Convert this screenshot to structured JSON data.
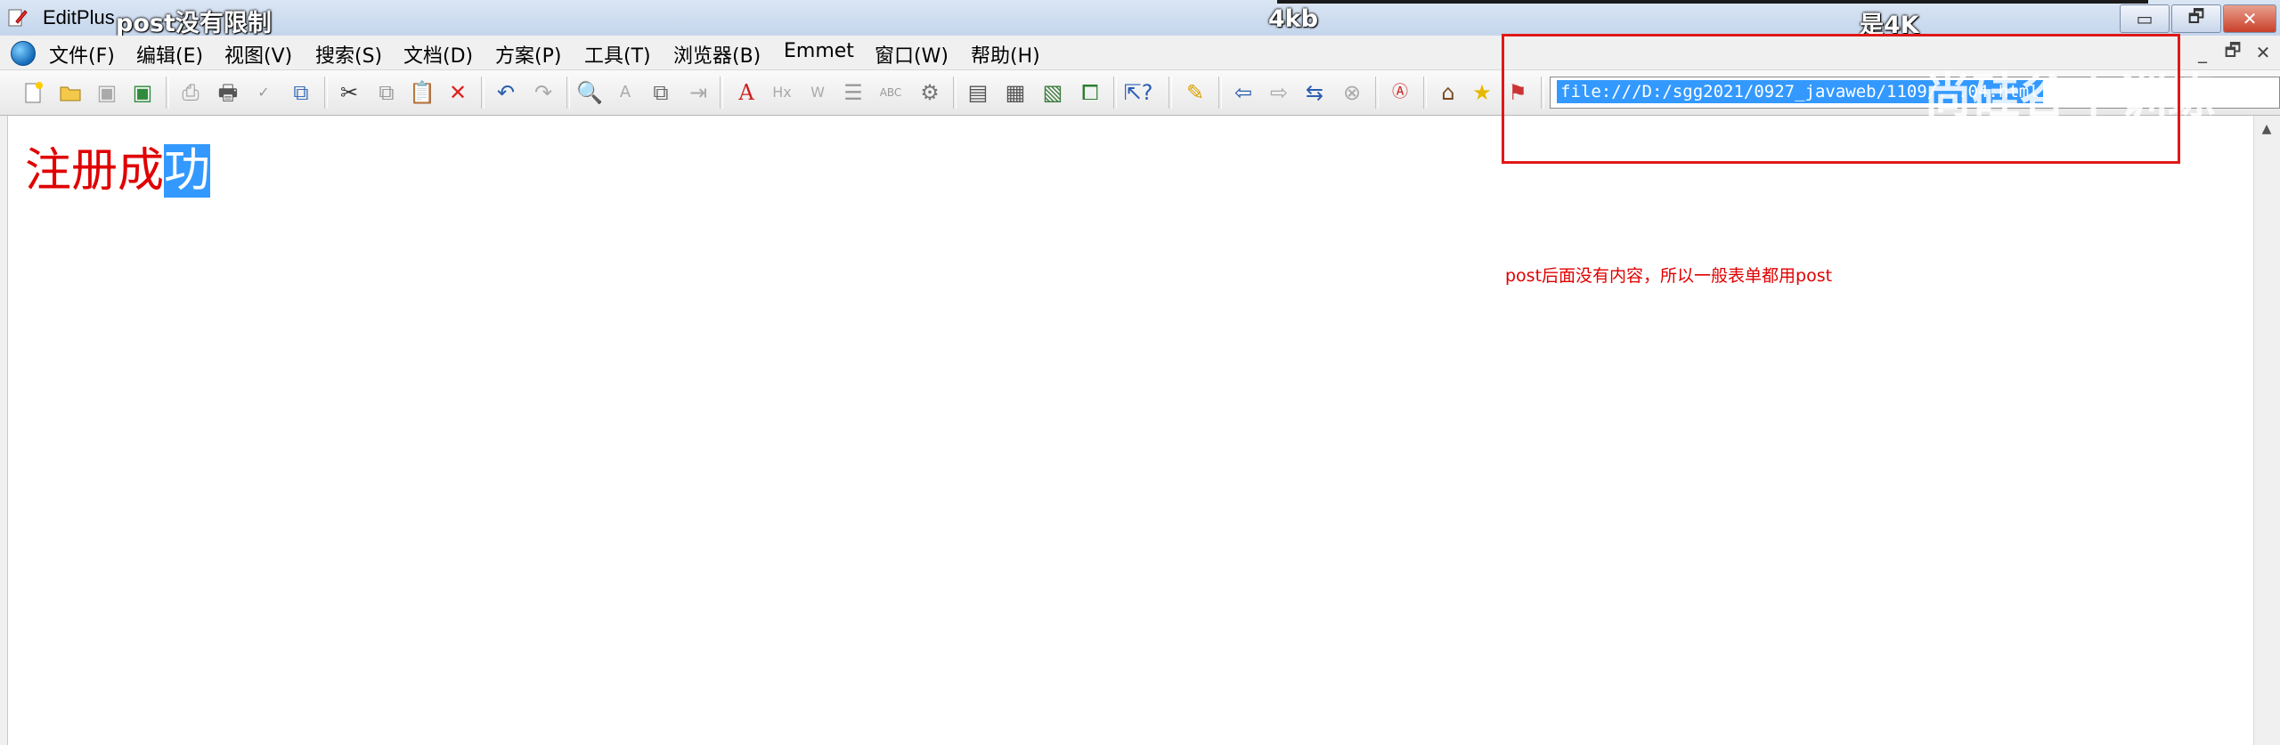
{
  "window": {
    "title": "EditPlus",
    "title_suffix": "- [",
    "buttons": {
      "minimize": "▭",
      "restore": "🗗",
      "close": "✕"
    }
  },
  "captions": {
    "left": "post没有限制",
    "center": "4kb",
    "right": "是4K"
  },
  "menu": {
    "items": [
      "文件(F)",
      "编辑(E)",
      "视图(V)",
      "搜索(S)",
      "文档(D)",
      "方案(P)",
      "工具(T)",
      "浏览器(B)",
      "Emmet",
      "窗口(W)",
      "帮助(H)"
    ],
    "mdi_buttons": [
      "_",
      "🗗",
      "✕"
    ]
  },
  "toolbar": {
    "url": "file:///D:/sgg2021/0927_javaweb/1109/...04.html",
    "watermark": "尚硅谷 | 训练"
  },
  "document": {
    "heading_normal": "注册成",
    "heading_selected": "功"
  },
  "annotation": {
    "note": "post后面没有内容，所以一般表单都用post"
  },
  "colors": {
    "accent": "#3399ff",
    "red_annotation": "#e00000",
    "highlight_box": "#e01818"
  }
}
